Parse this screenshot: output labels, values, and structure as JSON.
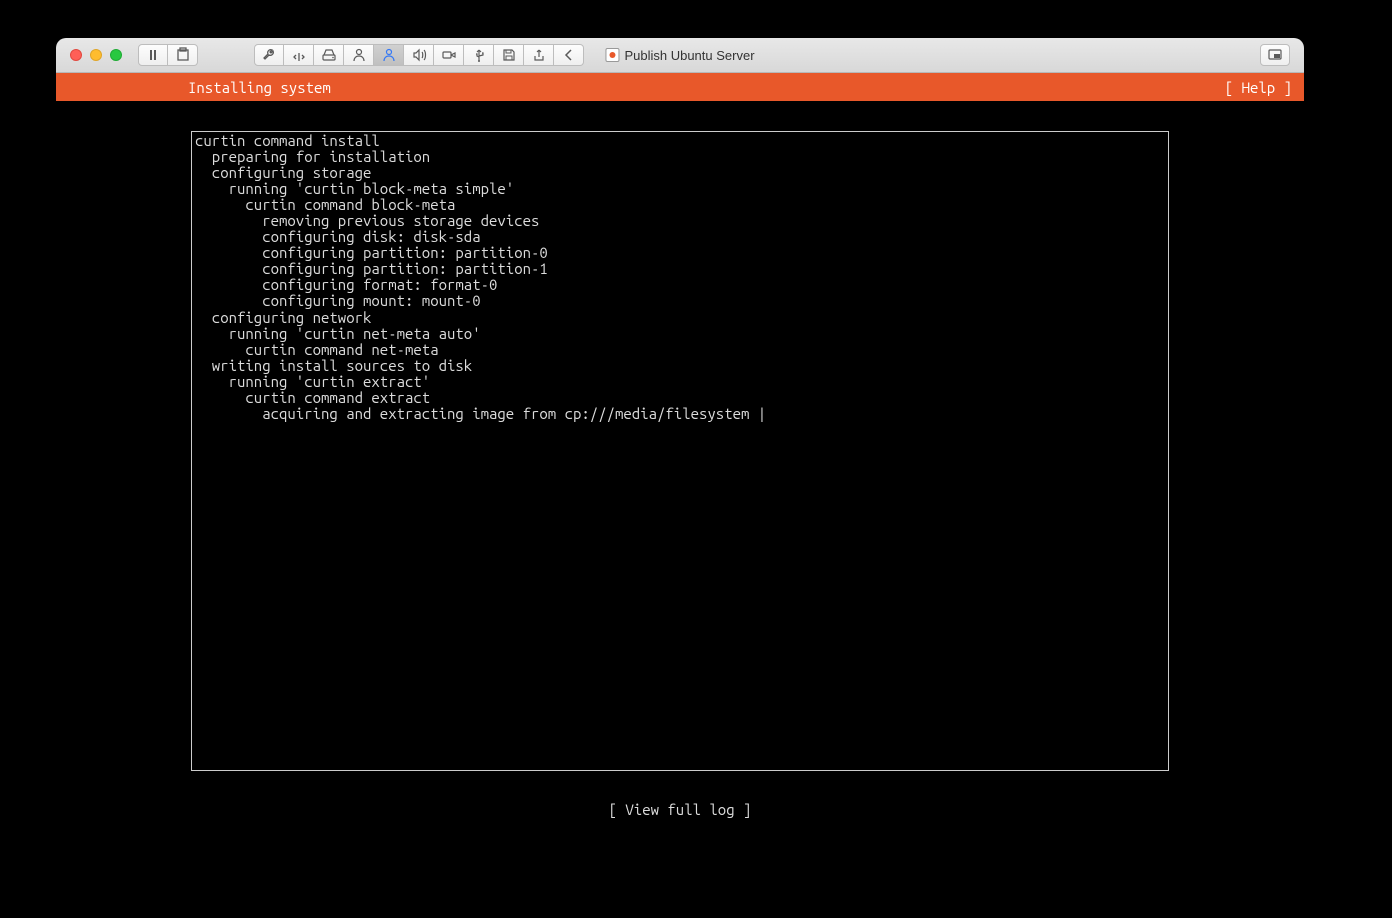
{
  "window": {
    "title": "Publish Ubuntu Server"
  },
  "installer": {
    "header_title": "Installing system",
    "help_label": "[ Help ]",
    "footer_label": "[ View full log ]",
    "spinner_char": "|",
    "log_lines": [
      {
        "indent": 0,
        "text": "curtin command install"
      },
      {
        "indent": 1,
        "text": "preparing for installation"
      },
      {
        "indent": 1,
        "text": "configuring storage"
      },
      {
        "indent": 2,
        "text": "running 'curtin block-meta simple'"
      },
      {
        "indent": 3,
        "text": "curtin command block-meta"
      },
      {
        "indent": 4,
        "text": "removing previous storage devices"
      },
      {
        "indent": 4,
        "text": "configuring disk: disk-sda"
      },
      {
        "indent": 4,
        "text": "configuring partition: partition-0"
      },
      {
        "indent": 4,
        "text": "configuring partition: partition-1"
      },
      {
        "indent": 4,
        "text": "configuring format: format-0"
      },
      {
        "indent": 4,
        "text": "configuring mount: mount-0"
      },
      {
        "indent": 1,
        "text": "configuring network"
      },
      {
        "indent": 2,
        "text": "running 'curtin net-meta auto'"
      },
      {
        "indent": 3,
        "text": "curtin command net-meta"
      },
      {
        "indent": 1,
        "text": "writing install sources to disk"
      },
      {
        "indent": 2,
        "text": "running 'curtin extract'"
      },
      {
        "indent": 3,
        "text": "curtin command extract"
      },
      {
        "indent": 4,
        "text": "acquiring and extracting image from cp:///media/filesystem",
        "spinner": true
      }
    ]
  }
}
